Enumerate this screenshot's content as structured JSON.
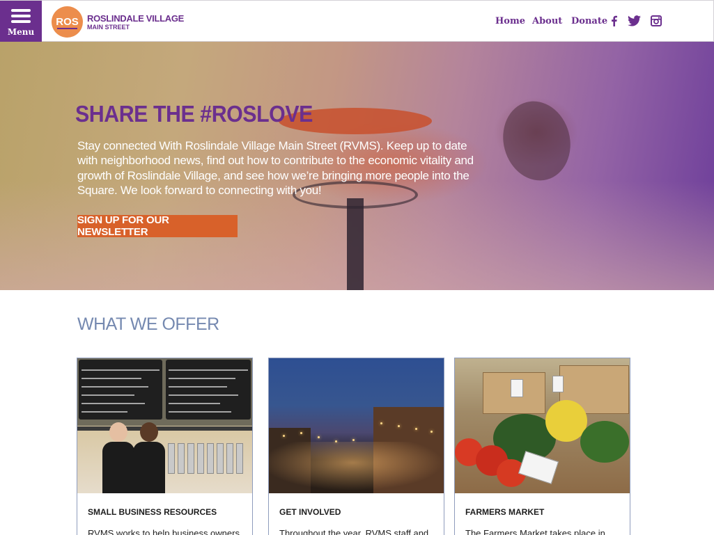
{
  "header": {
    "menu_label": "Menu",
    "logo_mark": "ROS",
    "logo_line1": "ROSLINDALE VILLAGE",
    "logo_line2": "MAIN STREET",
    "nav": [
      "Home",
      "About",
      "Donate"
    ],
    "social_icons": [
      "facebook-icon",
      "twitter-icon",
      "instagram-icon"
    ]
  },
  "hero": {
    "title": "SHARE THE #ROSLOVE",
    "body": "Stay connected With Roslindale Village Main Street (RVMS). Keep up to date with neighborhood news, find out how to contribute to the economic vitality and growth of Roslindale Village, and see how we’re bringing more people into the Square. We look forward to connecting with you!",
    "cta": "SIGN UP FOR OUR NEWSLETTER"
  },
  "offer": {
    "title": "WHAT WE OFFER",
    "cards": [
      {
        "title": "SMALL BUSINESS RESOURCES",
        "desc": "RVMS works to help business owners"
      },
      {
        "title": "GET INVOLVED",
        "desc": "Throughout the year, RVMS staff and"
      },
      {
        "title": "FARMERS MARKET",
        "desc": "The Farmers Market takes place in"
      }
    ]
  },
  "colors": {
    "brand_purple": "#6b2f8e",
    "brand_orange": "#d8612a",
    "logo_orange": "#ec8d4c",
    "offer_title": "#7589b0"
  }
}
